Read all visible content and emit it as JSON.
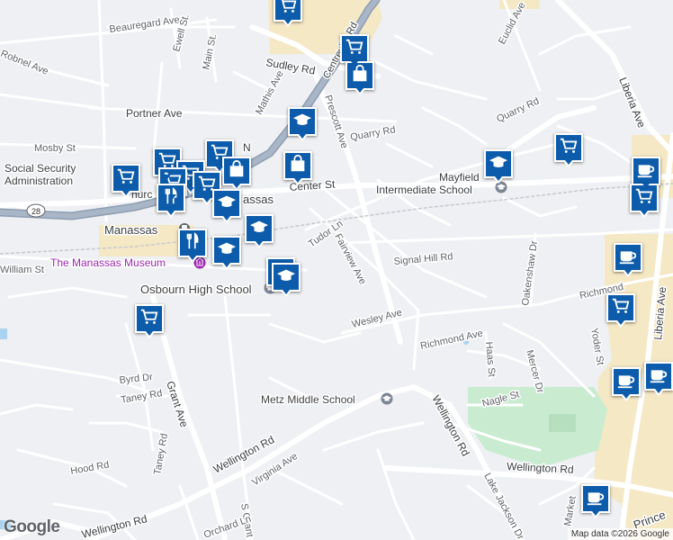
{
  "road_labels": {
    "beauregard_ave": "Beauregard Ave",
    "robnel_ave": "Robnel Ave",
    "ewell_st": "Ewell St.",
    "main_st": "Main St.",
    "sudley_rd": "Sudley Rd",
    "centreville_rd": "Centreville Rd",
    "euclid_ave": "Euclid Ave",
    "liberia_ave_north": "Liberia Ave",
    "mathis_ave": "Mathis Ave",
    "portner_ave": "Portner Ave",
    "prescott_ave": "Prescott Ave",
    "quarry_rd_west": "Quarry Rd",
    "quarry_rd_east": "Quarry Rd",
    "mosby_st": "Mosby St",
    "center_st": "Center St",
    "route_28": "28",
    "tudor_ln": "Tudor Ln",
    "fairview_ave": "Fairview Ave",
    "signal_hill_rd": "Signal Hill Rd",
    "william_st": "William St",
    "richmond_ave_east": "Richmond",
    "oakenshaw_dr": "Oakenshaw Dr",
    "wesley_ave": "Wesley Ave",
    "richmond_ave": "Richmond Ave",
    "yoder_st": "Yoder St",
    "liberia_ave_south": "Liberia Ave",
    "haas_st": "Haas St",
    "mercer_dr": "Mercer Dr",
    "byrd_dr": "Byrd Dr",
    "taney_rd": "Taney Rd",
    "grant_ave": "Grant Ave",
    "nagle_st": "Nagle St",
    "wellington_rd_diag": "Wellington Rd",
    "hood_rd": "Hood Rd",
    "taney_rd_south": "Taney Rd",
    "wellington_rd_west": "Wellington Rd",
    "virginia_ave": "Virginia Ave",
    "wellington_rd_east": "Wellington Rd",
    "lake_jackson_dr": "Lake Jackson Dr",
    "s_grant_ave": "S Grant Ave",
    "orchard_ln": "Orchard Ln",
    "market_st": "Market",
    "prince_william": "Prince",
    "wellington_rd_sw": "Wellington Rd"
  },
  "place_labels": {
    "social_security": "Social Security",
    "administration": "Administration",
    "mayfield_1": "Mayfield",
    "mayfield_2": "Intermediate School",
    "manassas_partial": "assas",
    "manassas": "Manassas",
    "museum": "The Manassas Museum",
    "osbourn": "Osbourn High School",
    "metz": "Metz Middle School",
    "church_partial": "hurc",
    "old_town_partial": "N"
  },
  "google_logo": "Google",
  "attribution": "Map data ©2026 Google",
  "colors": {
    "background": "#eef0f3",
    "road": "#ffffff",
    "highway": "#9aa9bd",
    "commercial": "#f5e8c5",
    "park": "#c9ecd1",
    "marker": "#0d5cab",
    "museum": "#9c27b0"
  },
  "markers": [
    {
      "icon": "cart",
      "name": "shopping-marker"
    },
    {
      "icon": "cart",
      "name": "shopping-marker"
    },
    {
      "icon": "bag",
      "name": "store-marker"
    },
    {
      "icon": "school",
      "name": "school-marker"
    },
    {
      "icon": "bag",
      "name": "store-marker"
    },
    {
      "icon": "cart",
      "name": "shopping-marker"
    },
    {
      "icon": "cart",
      "name": "shopping-marker"
    },
    {
      "icon": "cart",
      "name": "shopping-marker"
    },
    {
      "icon": "bag",
      "name": "store-marker"
    },
    {
      "icon": "cart",
      "name": "shopping-marker"
    },
    {
      "icon": "cart",
      "name": "shopping-marker"
    },
    {
      "icon": "cart",
      "name": "shopping-marker"
    },
    {
      "icon": "fork-knife",
      "name": "restaurant-marker"
    },
    {
      "icon": "school",
      "name": "school-marker"
    },
    {
      "icon": "school",
      "name": "school-marker"
    },
    {
      "icon": "fork-knife",
      "name": "restaurant-marker"
    },
    {
      "icon": "school",
      "name": "school-marker"
    },
    {
      "icon": "school",
      "name": "school-marker"
    },
    {
      "icon": "school",
      "name": "school-marker"
    },
    {
      "icon": "cart",
      "name": "shopping-marker"
    },
    {
      "icon": "school",
      "name": "school-marker"
    },
    {
      "icon": "cart",
      "name": "shopping-marker"
    },
    {
      "icon": "coffee",
      "name": "cafe-marker"
    },
    {
      "icon": "cart",
      "name": "shopping-marker"
    },
    {
      "icon": "coffee",
      "name": "cafe-marker"
    },
    {
      "icon": "cart",
      "name": "shopping-marker"
    },
    {
      "icon": "coffee",
      "name": "cafe-marker"
    },
    {
      "icon": "coffee",
      "name": "cafe-marker"
    },
    {
      "icon": "coffee",
      "name": "cafe-marker"
    }
  ]
}
